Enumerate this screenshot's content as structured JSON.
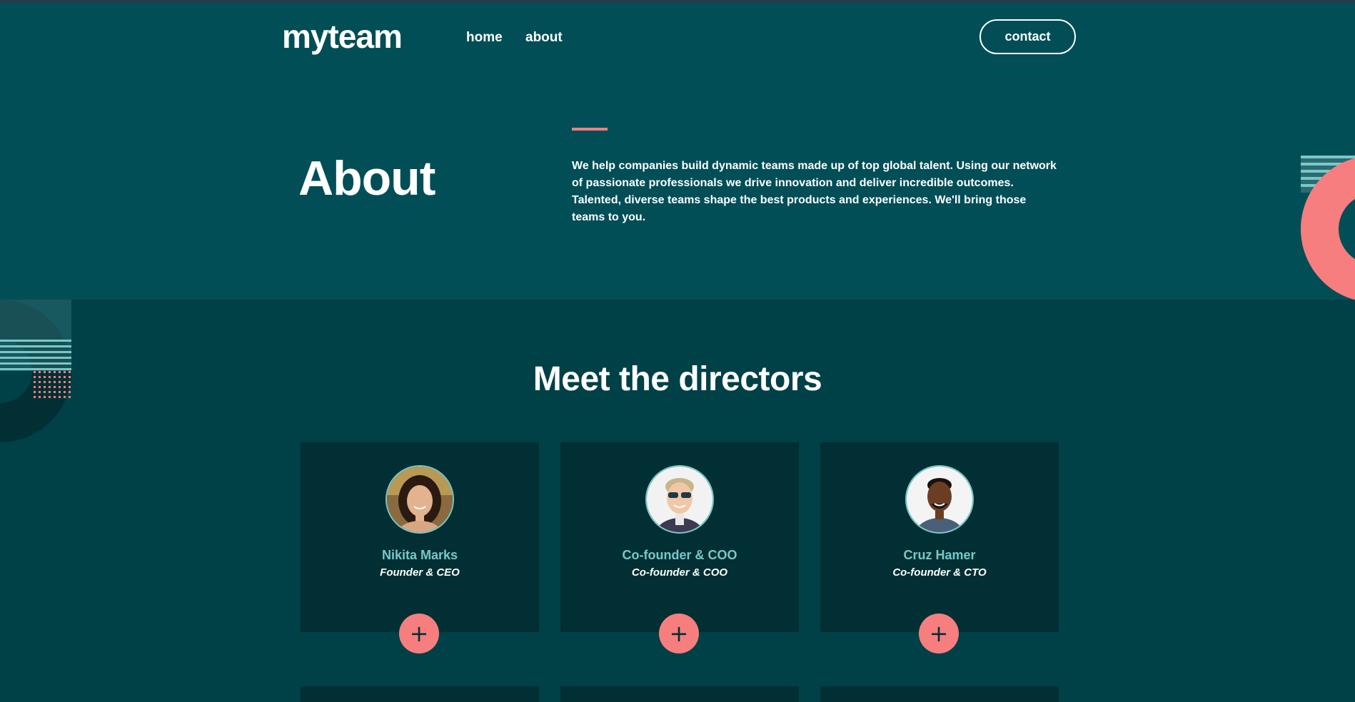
{
  "header": {
    "logo": "myteam",
    "nav": [
      {
        "label": "home"
      },
      {
        "label": "about"
      }
    ],
    "contact_label": "contact"
  },
  "hero": {
    "title": "About",
    "text": "We help companies build dynamic teams made up of top global talent. Using our network of passionate professionals we drive innovation and deliver incredible outcomes. Talented, diverse teams shape the best products and experiences. We'll bring those teams to you."
  },
  "directors": {
    "title": "Meet the directors",
    "cards": [
      {
        "name": "Nikita Marks",
        "role": "Founder & CEO",
        "expand_label": "+"
      },
      {
        "name": "Co-founder & COO",
        "role": "Co-founder & COO",
        "expand_label": "+"
      },
      {
        "name": "Cruz Hamer",
        "role": "Co-founder & CTO",
        "expand_label": "+"
      }
    ]
  },
  "colors": {
    "hero_bg": "#014e56",
    "section_bg": "#004047",
    "card_bg": "#012f34",
    "accent": "#f67e7e",
    "name": "#79c8c7"
  }
}
